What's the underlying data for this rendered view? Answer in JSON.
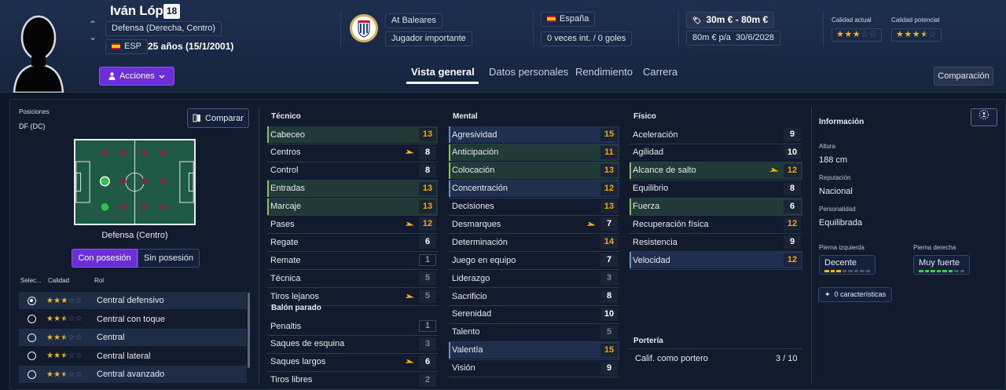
{
  "header": {
    "player_name": "Iván López",
    "squad_number": "18",
    "position": "Defensa (Derecha, Centro)",
    "nationality_code": "ESP",
    "age": "25 años (15/1/2001)",
    "actions_label": "Acciones",
    "club_name": "At Baleares",
    "club_status": "Jugador importante",
    "country": "España",
    "international": "0 veces int. / 0 goles",
    "value": "30m € - 80m €",
    "wage": "80m € p/a",
    "contract_end": "30/6/2028",
    "current_ability_label": "Calidad actual",
    "potential_ability_label": "Calidad potencial",
    "current_ability_stars": 3,
    "potential_ability_stars": 3.5,
    "comparison_label": "Comparación"
  },
  "tabs": [
    "Vista general",
    "Datos personales",
    "Rendimiento",
    "Carrera"
  ],
  "positions": {
    "label": "Posiciones",
    "value": "DF (DC)",
    "compare_label": "Comparar",
    "pitch_caption": "Defensa (Centro)",
    "in_possession": "Con posesión",
    "out_possession": "Sin posesión"
  },
  "roles": {
    "headers": [
      "Selec...",
      "Calidad",
      "Rol"
    ],
    "items": [
      {
        "name": "Central defensivo",
        "stars": 3,
        "selected": true
      },
      {
        "name": "Central con toque",
        "stars": 2.5,
        "selected": false
      },
      {
        "name": "Central",
        "stars": 2.5,
        "selected": false
      },
      {
        "name": "Central lateral",
        "stars": 2.5,
        "selected": false
      },
      {
        "name": "Central avanzado",
        "stars": 2.5,
        "selected": false
      }
    ]
  },
  "technical": {
    "title": "Técnico",
    "items": [
      {
        "name": "Cabeceo",
        "value": "13",
        "style": "hl",
        "color": "y"
      },
      {
        "name": "Centros",
        "value": "8",
        "style": "plain",
        "color": "w",
        "arrow": true
      },
      {
        "name": "Control",
        "value": "8",
        "style": "plain",
        "color": "w"
      },
      {
        "name": "Entradas",
        "value": "13",
        "style": "hl",
        "color": "y"
      },
      {
        "name": "Marcaje",
        "value": "13",
        "style": "hl",
        "color": "y"
      },
      {
        "name": "Pases",
        "value": "12",
        "style": "plain",
        "color": "y",
        "arrow": true
      },
      {
        "name": "Regate",
        "value": "6",
        "style": "plain",
        "color": "w"
      },
      {
        "name": "Remate",
        "value": "1",
        "style": "plain",
        "color": "gbox"
      },
      {
        "name": "Técnica",
        "value": "5",
        "style": "plain",
        "color": "g"
      },
      {
        "name": "Tiros lejanos",
        "value": "5",
        "style": "plain",
        "color": "g",
        "arrow": true
      }
    ]
  },
  "set_pieces": {
    "title": "Balón parado",
    "items": [
      {
        "name": "Penaltis",
        "value": "1",
        "style": "plain",
        "color": "gbox"
      },
      {
        "name": "Saques de esquina",
        "value": "3",
        "style": "plain",
        "color": "g"
      },
      {
        "name": "Saques largos",
        "value": "6",
        "style": "plain",
        "color": "w",
        "arrow": true
      },
      {
        "name": "Tiros libres",
        "value": "2",
        "style": "plain",
        "color": "g"
      }
    ]
  },
  "mental": {
    "title": "Mental",
    "items": [
      {
        "name": "Agresividad",
        "value": "15",
        "style": "blue",
        "color": "y"
      },
      {
        "name": "Anticipación",
        "value": "11",
        "style": "hl",
        "color": "y"
      },
      {
        "name": "Colocación",
        "value": "13",
        "style": "hl",
        "color": "y"
      },
      {
        "name": "Concentración",
        "value": "12",
        "style": "blue",
        "color": "y"
      },
      {
        "name": "Decisiones",
        "value": "13",
        "style": "plain",
        "color": "y"
      },
      {
        "name": "Desmarques",
        "value": "7",
        "style": "plain",
        "color": "w",
        "arrow": true
      },
      {
        "name": "Determinación",
        "value": "14",
        "style": "plain",
        "color": "y"
      },
      {
        "name": "Juego en equipo",
        "value": "7",
        "style": "plain",
        "color": "w"
      },
      {
        "name": "Liderazgo",
        "value": "3",
        "style": "plain",
        "color": "g"
      },
      {
        "name": "Sacrificio",
        "value": "8",
        "style": "plain",
        "color": "w"
      },
      {
        "name": "Serenidad",
        "value": "10",
        "style": "plain",
        "color": "w"
      },
      {
        "name": "Talento",
        "value": "5",
        "style": "plain",
        "color": "g"
      },
      {
        "name": "Valentía",
        "value": "15",
        "style": "blue",
        "color": "y"
      },
      {
        "name": "Visión",
        "value": "9",
        "style": "plain",
        "color": "w"
      }
    ]
  },
  "physical": {
    "title": "Físico",
    "items": [
      {
        "name": "Aceleración",
        "value": "9",
        "style": "plain",
        "color": "w"
      },
      {
        "name": "Agilidad",
        "value": "10",
        "style": "plain",
        "color": "w"
      },
      {
        "name": "Alcance de salto",
        "value": "12",
        "style": "hl",
        "color": "y",
        "arrow": true
      },
      {
        "name": "Equilibrio",
        "value": "8",
        "style": "plain",
        "color": "w"
      },
      {
        "name": "Fuerza",
        "value": "6",
        "style": "hl",
        "color": "w"
      },
      {
        "name": "Recuperación física",
        "value": "12",
        "style": "plain",
        "color": "y"
      },
      {
        "name": "Resistencia",
        "value": "9",
        "style": "plain",
        "color": "w"
      },
      {
        "name": "Velocidad",
        "value": "12",
        "style": "blue",
        "color": "y"
      }
    ]
  },
  "goalkeeping": {
    "title": "Portería",
    "label": "Calif. como portero",
    "value": "3 / 10"
  },
  "info": {
    "title": "Información",
    "height_label": "Altura",
    "height": "188 cm",
    "reputation_label": "Reputación",
    "reputation": "Nacional",
    "personality_label": "Personalidad",
    "personality": "Equilibrada",
    "left_foot_label": "Pierna izquierda",
    "left_foot": "Decente",
    "left_foot_level": 3,
    "right_foot_label": "Pierna derecha",
    "right_foot": "Muy fuerte",
    "right_foot_level": 6,
    "traits": "0 características"
  },
  "colors": {
    "accent": "#6a2fd6",
    "highlight_green": "#203a36",
    "highlight_blue": "#202f4d",
    "star": "#f2b91a",
    "value_high": "#f2a900"
  }
}
